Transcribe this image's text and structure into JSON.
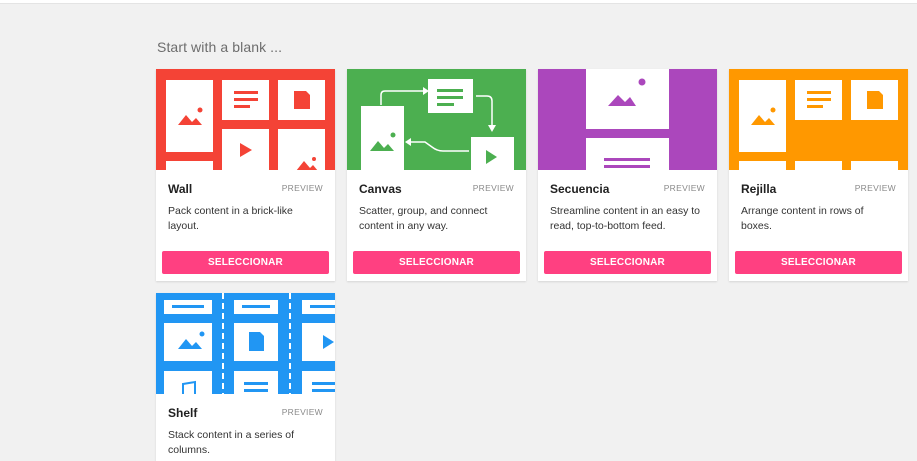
{
  "heading": "Start with a blank ...",
  "colors": {
    "accent_button": "#ff4081",
    "wall": "#f44336",
    "canvas": "#4caf50",
    "secuencia": "#ab47bc",
    "rejilla": "#ff9800",
    "shelf": "#2196f3"
  },
  "cards": [
    {
      "id": "wall",
      "title": "Wall",
      "preview": "PREVIEW",
      "description": "Pack content in a brick-like layout.",
      "button": "SELECCIONAR",
      "icons": [
        "image-icon",
        "text-icon",
        "document-icon",
        "play-icon",
        "image-icon"
      ]
    },
    {
      "id": "canvas",
      "title": "Canvas",
      "preview": "PREVIEW",
      "description": "Scatter, group, and connect content in any way.",
      "button": "SELECCIONAR",
      "icons": [
        "image-icon",
        "text-icon",
        "play-icon",
        "arrow-icon"
      ]
    },
    {
      "id": "secuencia",
      "title": "Secuencia",
      "preview": "PREVIEW",
      "description": "Streamline content in an easy to read, top-to-bottom feed.",
      "button": "SELECCIONAR",
      "icons": [
        "image-icon",
        "text-icon"
      ]
    },
    {
      "id": "rejilla",
      "title": "Rejilla",
      "preview": "PREVIEW",
      "description": "Arrange content in rows of boxes.",
      "button": "SELECCIONAR",
      "icons": [
        "image-icon",
        "text-icon",
        "document-icon"
      ]
    },
    {
      "id": "shelf",
      "title": "Shelf",
      "preview": "PREVIEW",
      "description": "Stack content in a series of columns.",
      "button": "SELECCIONAR",
      "icons": [
        "image-icon",
        "document-icon",
        "play-icon",
        "music-icon",
        "text-icon"
      ]
    }
  ]
}
